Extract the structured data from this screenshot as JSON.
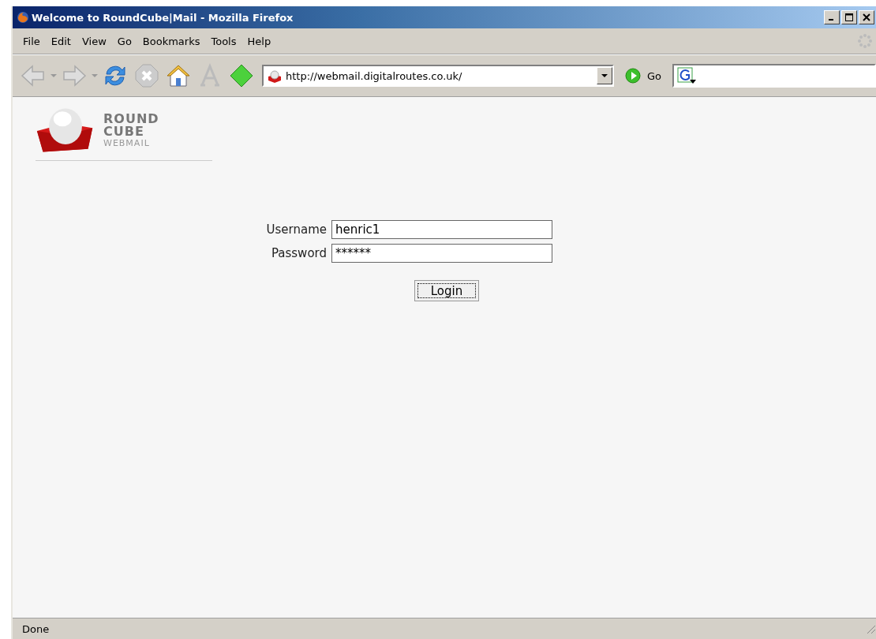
{
  "window": {
    "title": "Welcome to RoundCube|Mail - Mozilla Firefox"
  },
  "menu": [
    "File",
    "Edit",
    "View",
    "Go",
    "Bookmarks",
    "Tools",
    "Help"
  ],
  "address_bar": {
    "url": "http://webmail.digitalroutes.co.uk/"
  },
  "go_button": "Go",
  "logo": {
    "line_1": "ROUND",
    "line_2": "CUBE",
    "line_3": "WEBMAIL"
  },
  "login": {
    "fields": [
      {
        "label": "Username",
        "value": "henric1"
      },
      {
        "label": "Password",
        "value": "******"
      }
    ],
    "button": "Login"
  },
  "status_bar": "Done"
}
